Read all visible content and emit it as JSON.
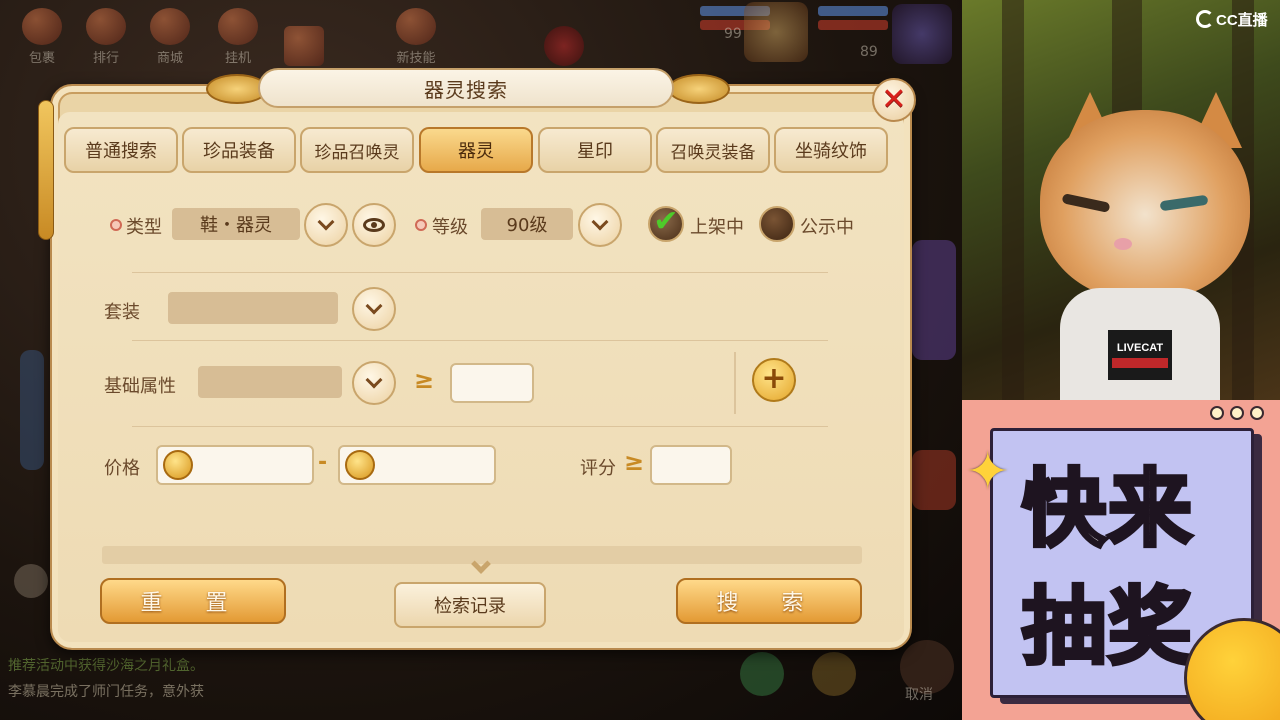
{
  "game": {
    "top_icons": [
      "包裹",
      "排行",
      "商城",
      "挂机",
      "",
      "新技能"
    ],
    "hud_numbers": [
      "99",
      "89"
    ],
    "chat": [
      "推荐活动中获得沙海之月礼盒。",
      "李慕晨完成了师门任务，意外获"
    ],
    "cancel_label": "取消"
  },
  "dialog": {
    "title": "器灵搜索",
    "close_icon": "close-icon",
    "tabs": [
      {
        "label": "普通搜索",
        "active": false
      },
      {
        "label": "珍品装备",
        "active": false
      },
      {
        "label": "珍品召唤灵",
        "active": false
      },
      {
        "label": "器灵",
        "active": true
      },
      {
        "label": "星印",
        "active": false
      },
      {
        "label": "召唤灵装备",
        "active": false
      },
      {
        "label": "坐骑纹饰",
        "active": false
      }
    ],
    "type": {
      "label": "类型",
      "value": "鞋・器灵"
    },
    "level": {
      "label": "等级",
      "value": "90级"
    },
    "listed": {
      "label": "上架中",
      "checked": true
    },
    "public": {
      "label": "公示中",
      "checked": false
    },
    "set": {
      "label": "套装",
      "value": ""
    },
    "base_attr": {
      "label": "基础属性",
      "value": "",
      "compare": "≥",
      "min": ""
    },
    "price": {
      "label": "价格",
      "min": "",
      "separator": "-",
      "max": ""
    },
    "score": {
      "label": "评分",
      "compare": "≥",
      "min": ""
    },
    "buttons": {
      "reset": "重 置",
      "history": "检索记录",
      "search": "搜 索"
    }
  },
  "overlay": {
    "brand": "CC直播",
    "shirt_text": "LIVECAT",
    "promo_line1": "快来",
    "promo_line2": "抽奖"
  }
}
